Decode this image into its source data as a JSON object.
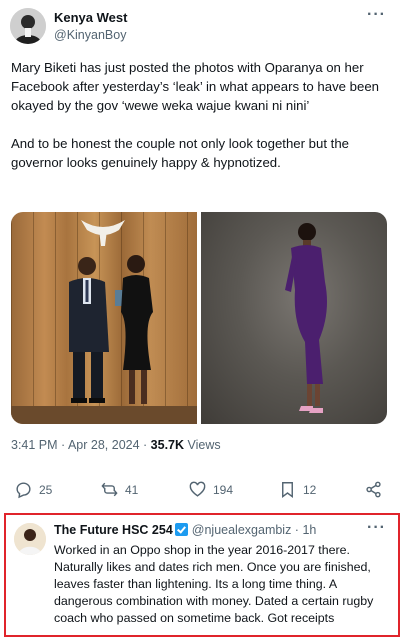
{
  "tweet": {
    "author_name": "Kenya West",
    "author_handle": "@KinyanBoy",
    "more_label": "···",
    "paragraphs": [
      "Mary Biketi has just posted the photos with Oparanya on her Facebook after yesterday’s ‘leak’ in what appears to have been okayed by the gov ‘wewe weka wajue kwani ni nini’",
      "And to be honest the couple not only look together but the governor looks genuinely happy & hypnotized."
    ],
    "timestamp": "3:41 PM · Apr 28, 2024 · ",
    "views_count": "35.7K",
    "views_label": " Views",
    "actions": {
      "replies": "25",
      "reposts": "41",
      "likes": "194",
      "bookmarks": "12"
    }
  },
  "reply": {
    "author_name": "The Future HSC 254",
    "author_handle": "@njuealexgambiz · 1h",
    "more_label": "···",
    "text": "Worked in an Oppo shop in the year 2016-2017 there. Naturally likes and dates rich men. Once you are finished, leaves faster than lightening. Its a long time thing. A dangerous combination with money. Dated a certain rugby coach who passed on sometime back. Got receipts"
  },
  "colors": {
    "highlight_border": "#e0242b",
    "verified_badge": "#1d9bf0",
    "secondary_text": "#536471"
  },
  "icons": [
    "reply-icon",
    "repost-icon",
    "like-icon",
    "bookmark-icon",
    "share-icon",
    "verified-icon",
    "more-icon"
  ]
}
